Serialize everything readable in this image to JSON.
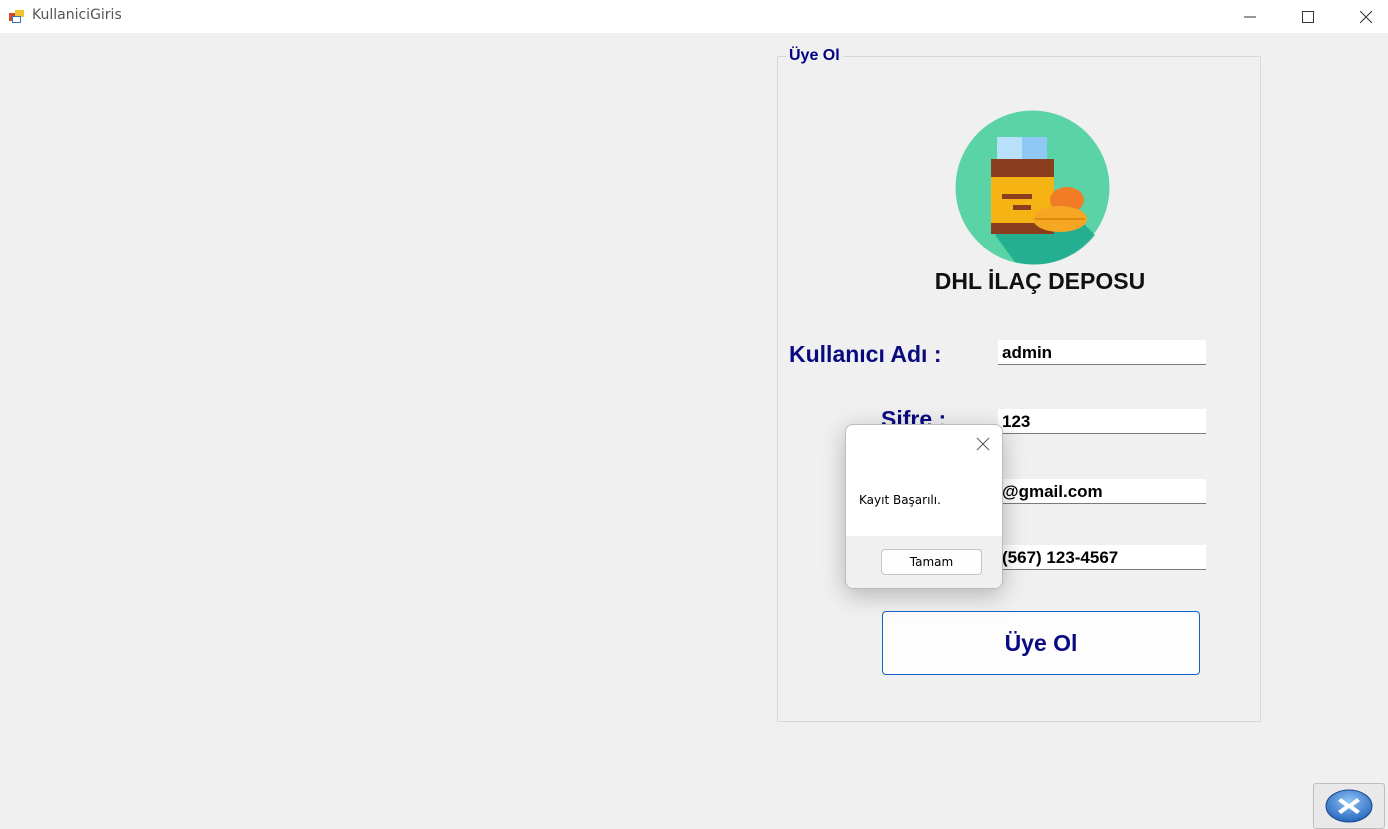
{
  "window": {
    "title": "KullaniciGiris",
    "icon": "form-icon",
    "controls": [
      "minimize-icon",
      "maximize-icon",
      "close-icon"
    ]
  },
  "group": {
    "legend": "Üye Ol"
  },
  "brand": {
    "logo_icon": "medicine-bottle-icon",
    "name": "DHL İLAÇ DEPOSU"
  },
  "form": {
    "username_label": "Kullanıcı Adı :",
    "username_value": "admin",
    "password_label": "Sifre :",
    "password_value": "123",
    "email_value": "@gmail.com",
    "phone_value": "(567) 123-4567",
    "submit_label": "Üye Ol"
  },
  "exit_button": {
    "icon": "exit-x-icon"
  },
  "message_box": {
    "text": "Kayıt Başarılı.",
    "ok_label": "Tamam"
  },
  "colors": {
    "label_navy": "#0a0a80",
    "logo_circle": "#5ad3a6",
    "button_border": "#1464c8"
  }
}
